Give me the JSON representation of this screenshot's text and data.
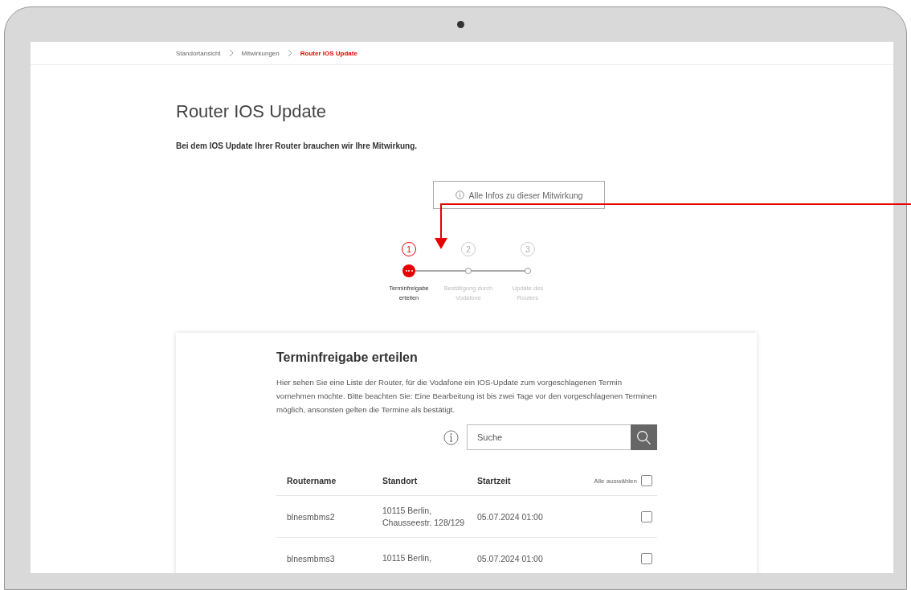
{
  "breadcrumb": [
    {
      "label": "Standortansicht",
      "current": false
    },
    {
      "label": "Mitwirkungen",
      "current": false
    },
    {
      "label": "Router IOS Update",
      "current": true
    }
  ],
  "title": "Router IOS Update",
  "subtitle": "Bei dem IOS Update Ihrer Router brauchen wir Ihre Mitwirkung.",
  "info_button": {
    "label": "Alle Infos zu dieser Mitwirkung"
  },
  "stepper": [
    {
      "number": "1",
      "label": "Terminfreigabe erteilen",
      "active": true
    },
    {
      "number": "2",
      "label": "Bestätigung durch Vodafone",
      "active": false
    },
    {
      "number": "3",
      "label": "Update des Routers",
      "active": false
    }
  ],
  "card": {
    "heading": "Terminfreigabe erteilen",
    "text": "Hier sehen Sie eine Liste der Router, für die Vodafone ein IOS-Update zum vorgeschlagenen Termin vornehmen möchte. Bitte beachten Sie: Eine Bearbeitung ist bis zwei Tage vor den vorgeschlagenen Terminen möglich, ansonsten gelten die Termine als bestätigt.",
    "search": {
      "placeholder": "Suche"
    },
    "table": {
      "columns": [
        "Routername",
        "Standort",
        "Startzeit"
      ],
      "select_all": {
        "label": "Alle auswählen",
        "checked": false
      },
      "rows": [
        {
          "name": "blnesmbms2",
          "location": "10115 Berlin, Chausseestr. 128/129",
          "start": "05.07.2024 01:00",
          "checked": false
        },
        {
          "name": "blnesmbms3",
          "location": "10115 Berlin,",
          "start": "05.07.2024 01:00",
          "checked": false
        }
      ]
    }
  }
}
